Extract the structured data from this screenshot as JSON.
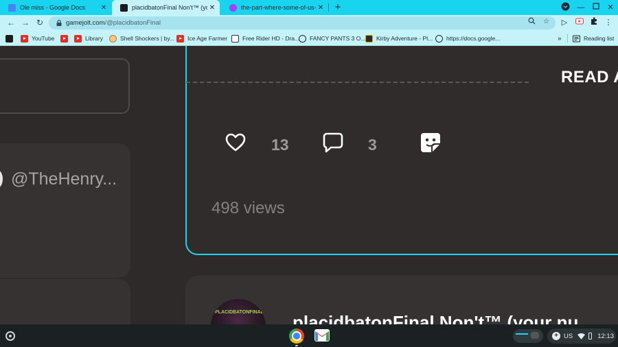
{
  "tabs": [
    {
      "title": "Ole miss - Google Docs",
      "icon": "google-docs-icon",
      "active": false
    },
    {
      "title": "placidbatonFinal Non't™ (your n",
      "icon": "gamejolt-icon",
      "active": true
    },
    {
      "title": "the-part-where-some-of-us-need-",
      "icon": "page-icon",
      "active": false
    }
  ],
  "toolbar": {
    "url_host": "gamejolt.com",
    "url_path": "/@placidbatonFinal"
  },
  "bookmarks": [
    {
      "label": "",
      "icon": "gamejolt-icon"
    },
    {
      "label": "YouTube",
      "icon": "youtube-icon"
    },
    {
      "label": "",
      "icon": "youtube-icon"
    },
    {
      "label": "Library",
      "icon": "youtube-icon"
    },
    {
      "label": "Shell Shockers | by...",
      "icon": "shellshock-icon"
    },
    {
      "label": "Ice Age Farmer",
      "icon": "youtube-icon"
    },
    {
      "label": "Free Rider HD - Dra...",
      "icon": "freerider-icon"
    },
    {
      "label": "FANCY PANTS 3 O...",
      "icon": "globe-icon"
    },
    {
      "label": "Kirby Adventure - Pl...",
      "icon": "kirby-icon"
    },
    {
      "label": "https://docs.google...",
      "icon": "globe-icon"
    }
  ],
  "reading_list": "Reading list",
  "page": {
    "user_handle": "@TheHenry...",
    "read_more": "READ A",
    "like_count": "13",
    "comment_count": "3",
    "views": "498 views",
    "post2_avatar_text": "PLACIDBATONFINAL",
    "post2_title": "placidbatonFinal Non't™ (your nu"
  },
  "shelf": {
    "locale": "US",
    "time": "12:13"
  },
  "colors": {
    "tab_strip": "#18d4ee",
    "toolbar": "#c6f2fa",
    "page_bg": "#2d2a29",
    "accent": "#1fd6ee"
  }
}
